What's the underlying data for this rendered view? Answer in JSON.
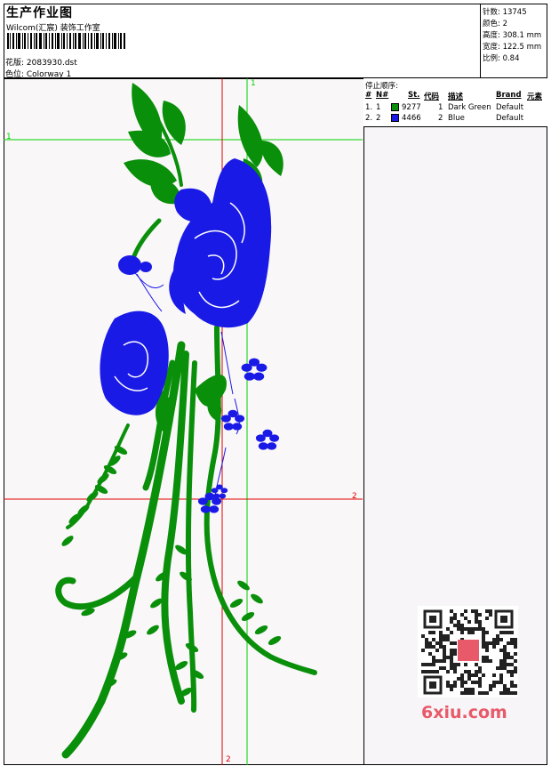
{
  "header": {
    "title": "生产作业图",
    "studio": "Wilcom(汇宸) 装饰工作室",
    "design_file": "花版: 2083930.dst",
    "colorway": "色位: Colorway 1"
  },
  "stats": {
    "stitches": "针数: 13745",
    "colors": "颜色: 2",
    "height": "高度: 308.1 mm",
    "width": "宽度: 122.5 mm",
    "scale": "比例: 0.84"
  },
  "threads": {
    "section_label": "停止顺序:",
    "columns": [
      "#",
      "N#",
      "St.",
      "代码",
      "描述",
      "Brand",
      "元素"
    ],
    "rows": [
      {
        "index": "1.",
        "n": "1",
        "code": "9277",
        "st": "1",
        "desc": "Dark Green",
        "brand": "Default",
        "color": "#0a8f0a"
      },
      {
        "index": "2.",
        "n": "2",
        "code": "4466",
        "st": "2",
        "desc": "Blue",
        "brand": "Default",
        "color": "#1a1ae6"
      }
    ]
  },
  "guides": {
    "label_top": "1",
    "label_left": "1",
    "label_right": "2",
    "label_bottom": "2"
  },
  "colors": {
    "green": "#0a8f0a",
    "blue": "#1a1ae6",
    "guide_red": "#e00000",
    "guide_green": "#00d000"
  },
  "watermark": {
    "logo_text": "6xiu.com"
  }
}
